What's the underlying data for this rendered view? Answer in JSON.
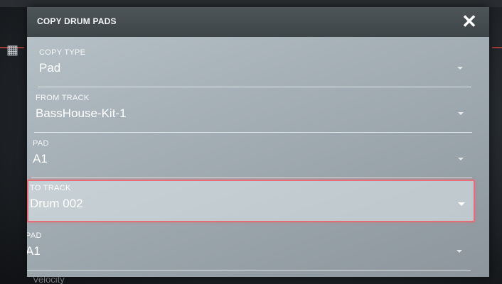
{
  "dialog": {
    "title": "COPY DRUM PADS",
    "close_icon": "close-icon"
  },
  "fields": [
    {
      "label": "COPY TYPE",
      "value": "Pad",
      "selected": false
    },
    {
      "label": "FROM TRACK",
      "value": "BassHouse-Kit-1",
      "selected": false
    },
    {
      "label": "PAD",
      "value": "A1",
      "selected": false
    },
    {
      "label": "TO TRACK",
      "value": "Drum 002",
      "selected": true
    },
    {
      "label": "PAD",
      "value": "A1",
      "selected": false
    }
  ],
  "background": {
    "partial_label": "Velocity",
    "grid_icon": "pad-grid-icon"
  },
  "colors": {
    "dialog_header": "#454d51",
    "selection_border": "#e46d77",
    "accent_red": "#c4453f"
  }
}
